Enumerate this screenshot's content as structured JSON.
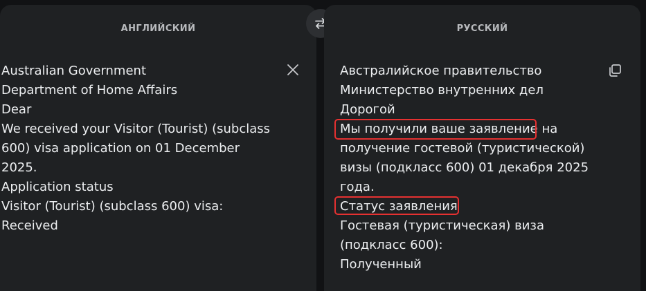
{
  "source": {
    "language_label": "АНГЛИЙСКИЙ",
    "text": "Australian Government\nDepartment of Home Affairs\nDear\nWe received your Visitor (Tourist) (subclass\n600) visa application on 01 December 2025.\nApplication status\nVisitor (Tourist) (subclass 600) visa:\nReceived"
  },
  "target": {
    "language_label": "РУССКИЙ",
    "text": "Австралийское правительство\nМинистерство внутренних дел\nДорогой\nМы получили ваше заявление на\nполучение гостевой (туристической)\nвизы (подкласс 600) 01 декабря 2025\nгода.\nСтатус заявления\nГостевая (туристическая) виза\n(подкласс 600):\nПолученный"
  },
  "icons": {
    "swap": "swap-arrows-icon",
    "clear": "close-icon",
    "copy": "copy-icon"
  },
  "colors": {
    "background": "#111214",
    "panel": "#1f2123",
    "text": "#eceef0",
    "label": "#b8babd",
    "highlight": "#e63131"
  }
}
